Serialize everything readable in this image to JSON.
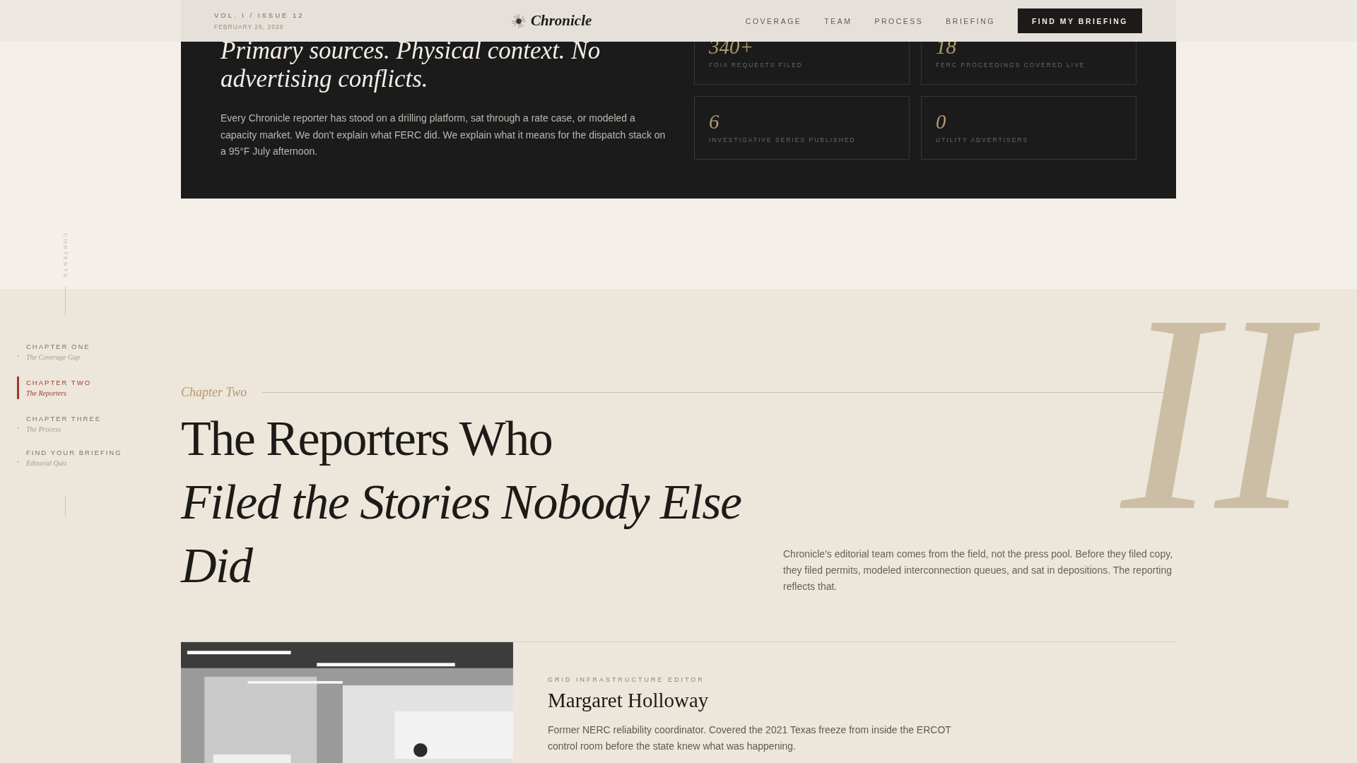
{
  "header": {
    "issue": "VOL. I / ISSUE 12",
    "date": "FEBRUARY 26, 2026",
    "logo": "Chronicle",
    "nav": [
      {
        "label": "COVERAGE"
      },
      {
        "label": "TEAM"
      },
      {
        "label": "PROCESS"
      },
      {
        "label": "BRIEFING"
      }
    ],
    "cta": "FIND MY BRIEFING"
  },
  "intro": {
    "headline": "Primary sources. Physical context. No advertising conflicts.",
    "body": "Every Chronicle reporter has stood on a drilling platform, sat through a rate case, or modeled a capacity market. We don't explain what FERC did. We explain what it means for the dispatch stack on a 95°F July afternoon.",
    "stats": [
      {
        "value": "340+",
        "label": "FOIA REQUESTS FILED"
      },
      {
        "value": "18",
        "label": "FERC PROCEEDINGS COVERED LIVE"
      },
      {
        "value": "6",
        "label": "INVESTIGATIVE SERIES PUBLISHED"
      },
      {
        "value": "0",
        "label": "UTILITY ADVERTISERS"
      }
    ]
  },
  "contents": {
    "label": "CONTENTS",
    "items": [
      {
        "chapter": "CHAPTER ONE",
        "title": "The Coverage Gap",
        "selected": false
      },
      {
        "chapter": "CHAPTER TWO",
        "title": "The Reporters",
        "selected": true
      },
      {
        "chapter": "CHAPTER THREE",
        "title": "The Process",
        "selected": false
      },
      {
        "chapter": "FIND YOUR BRIEFING",
        "title": "Editorial Quiz",
        "selected": false
      }
    ]
  },
  "chapter": {
    "eyebrow": "Chapter Two",
    "watermark": "II",
    "title_plain": "The Reporters Who",
    "title_italic": "Filed the Stories Nobody Else Did",
    "intro": "Chronicle's editorial team comes from the field, not the press pool. Before they filed copy, they filed permits, modeled interconnection queues, and sat in depositions. The reporting reflects that.",
    "reporter": {
      "role": "GRID INFRASTRUCTURE EDITOR",
      "name": "Margaret Holloway",
      "bio": "Former NERC reliability coordinator. Covered the 2021 Texas freeze from inside the ERCOT control room before the state knew what was happening."
    }
  }
}
